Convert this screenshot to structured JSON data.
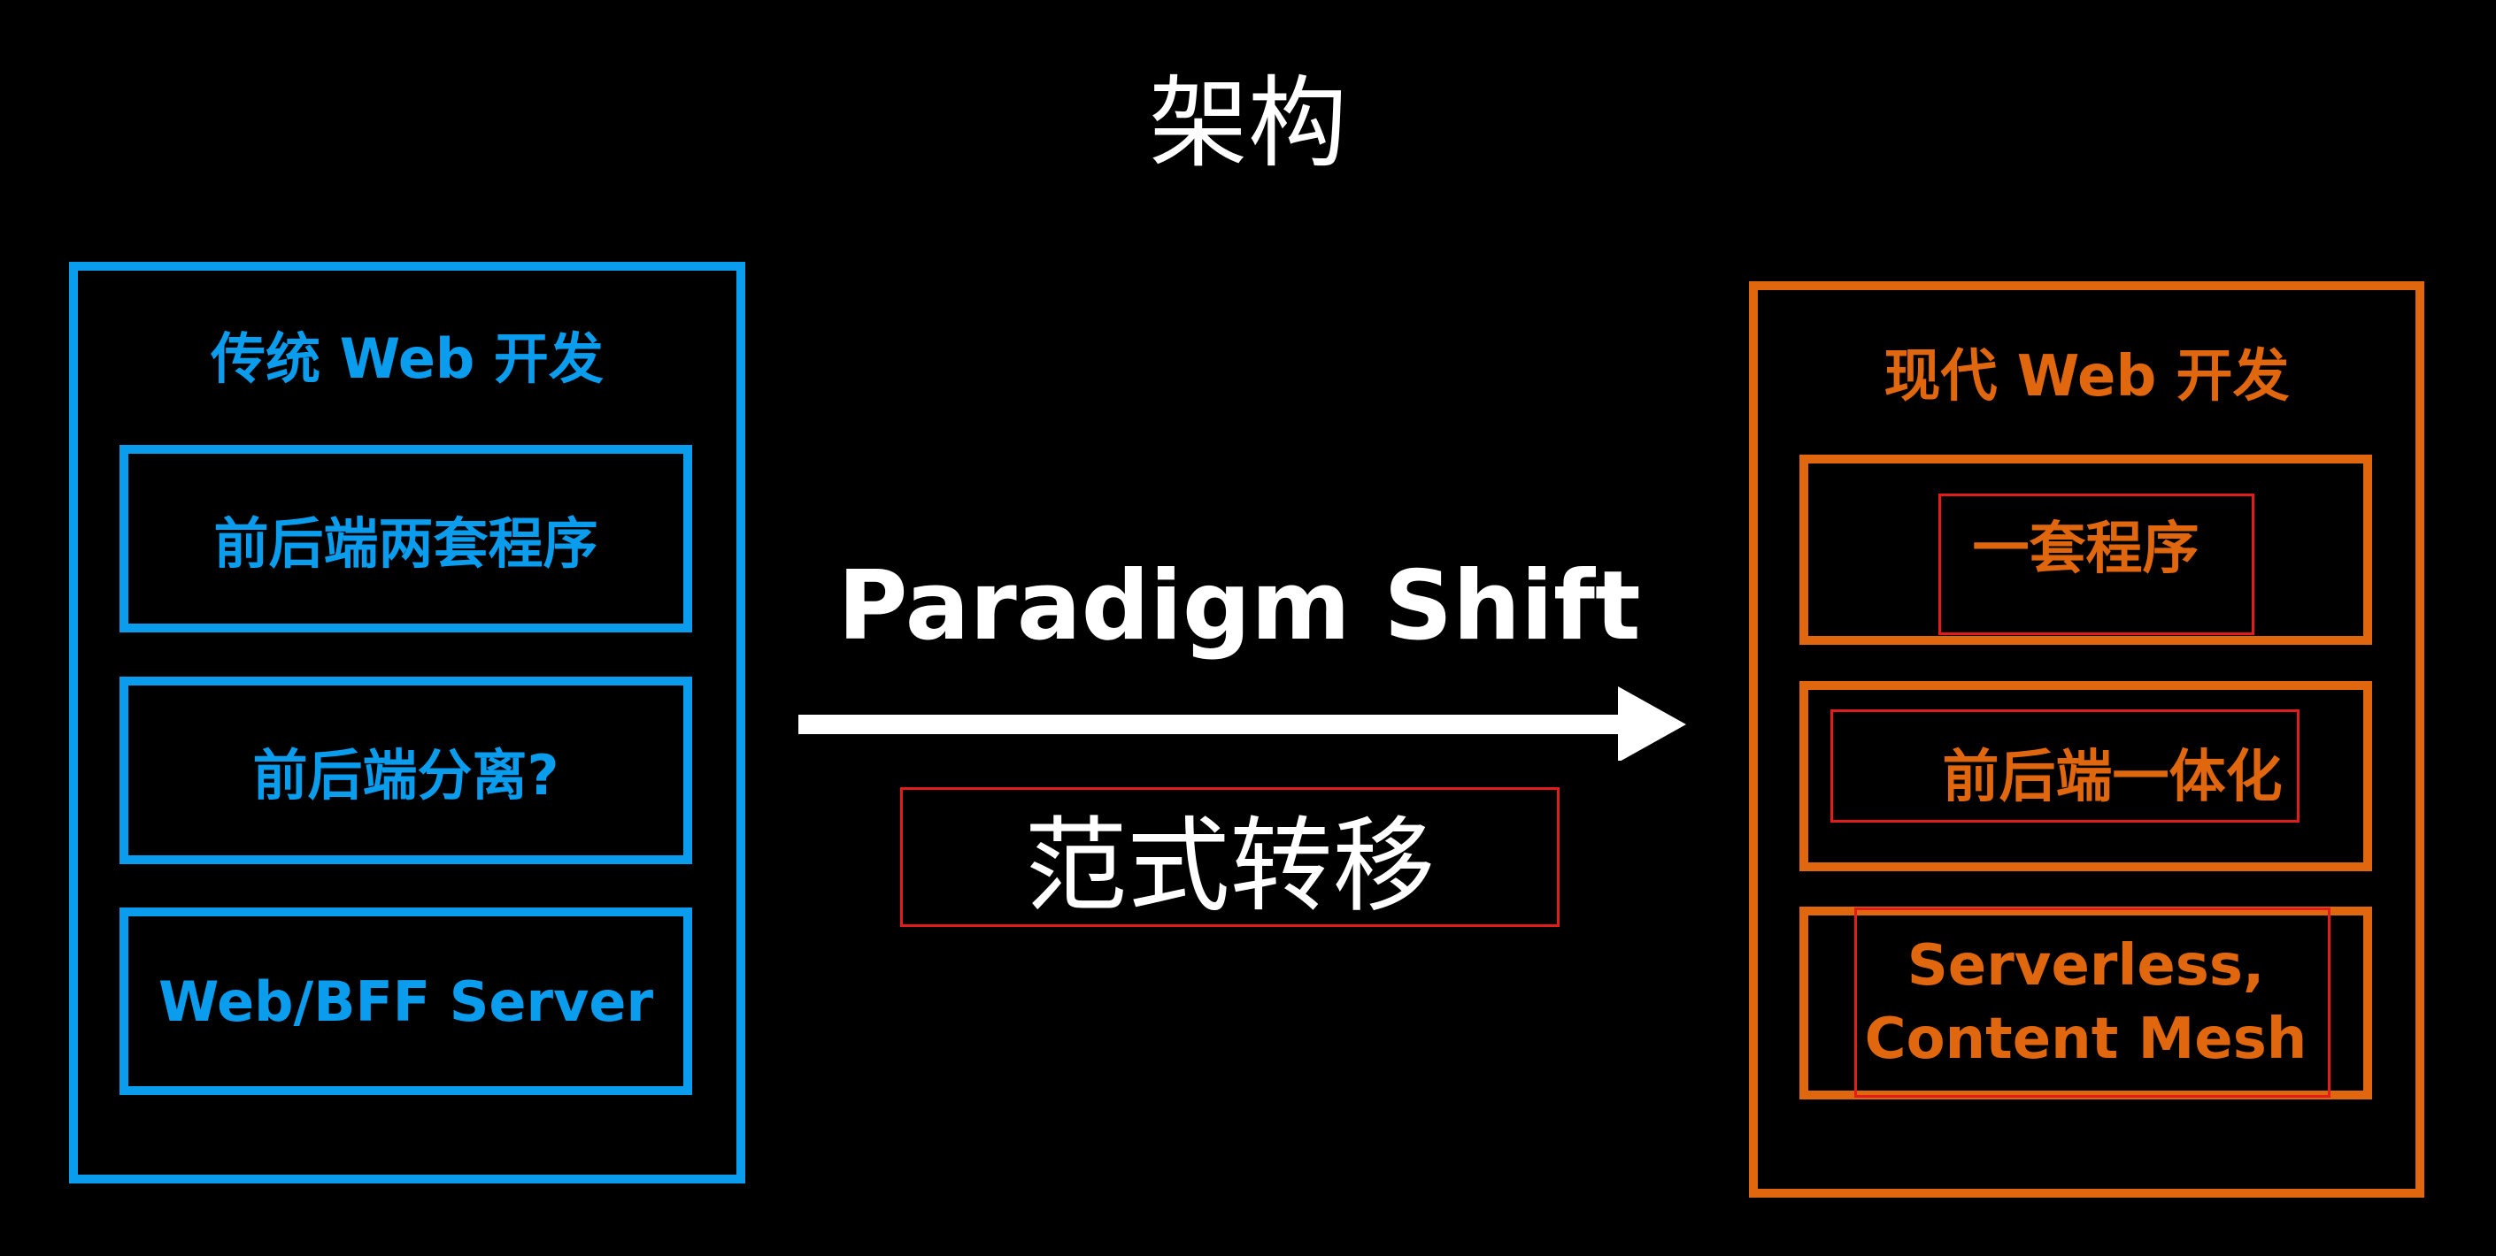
{
  "title": "架构",
  "left": {
    "title": "传统 Web 开发",
    "items": [
      "前后端两套程序",
      "前后端分离?",
      "Web/BFF Server"
    ],
    "color": "#0a9dee"
  },
  "middle": {
    "label": "Paradigm Shift",
    "label_cn": "范式转移",
    "arrow_color": "#ffffff",
    "highlight_color": "#e21b1b"
  },
  "right": {
    "title": "现代 Web 开发",
    "items": [
      "一套程序",
      "前后端一体化",
      "Serverless,",
      "Content Mesh"
    ],
    "color": "#e0670e"
  }
}
